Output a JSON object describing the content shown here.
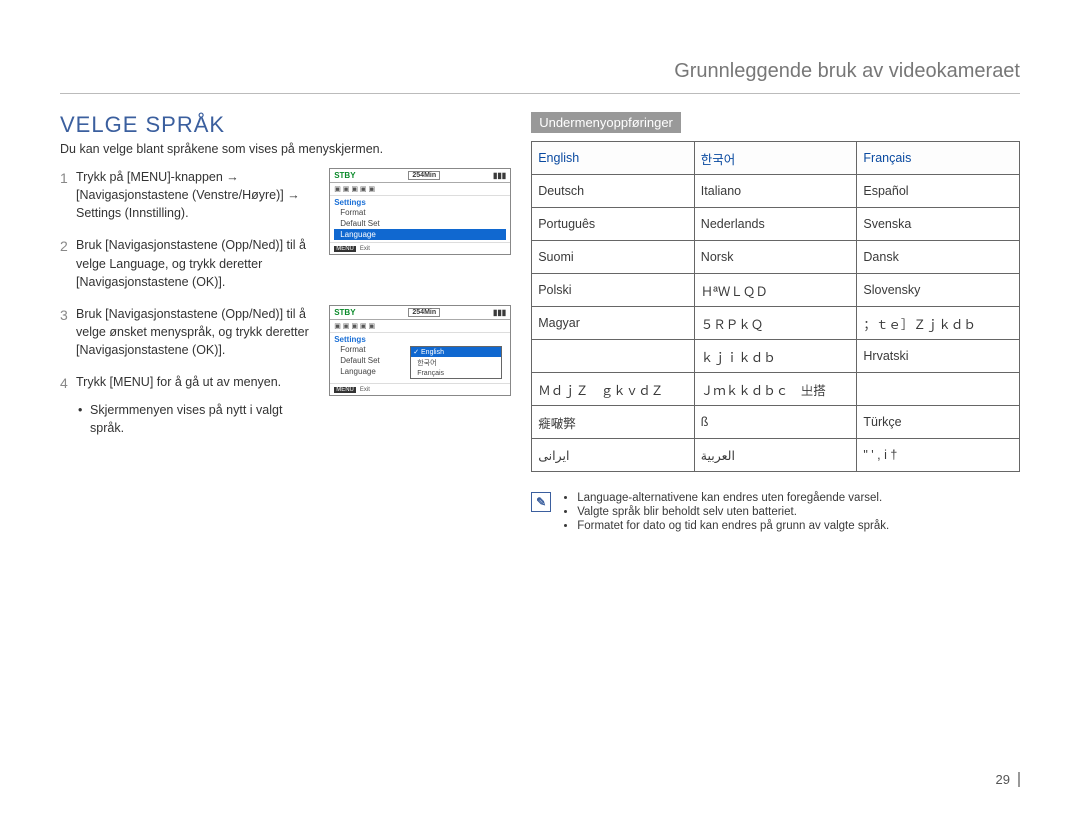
{
  "header": {
    "breadcrumb": "Grunnleggende bruk av videokameraet"
  },
  "page_number": "29",
  "left": {
    "title": "VELGE SPRÅK",
    "intro": "Du kan velge blant språkene som vises på menyskjermen.",
    "steps": [
      {
        "num": "1",
        "text": "Trykk på [MENU]-knappen → [Navigasjonstastene (Venstre/Høyre)] → Settings (Innstilling)."
      },
      {
        "num": "2",
        "text": "Bruk [Navigasjonstastene (Opp/Ned)] til å velge Language, og trykk deretter [Navigasjonstastene (OK)]."
      },
      {
        "num": "3",
        "text": "Bruk [Navigasjonstastene (Opp/Ned)] til å velge ønsket menyspråk, og trykk deretter [Navigasjonstastene (OK)]."
      },
      {
        "num": "4",
        "text": "Trykk [MENU] for å gå ut av menyen.",
        "bullet": "Skjermmenyen vises på nytt i valgt språk."
      }
    ]
  },
  "osd": {
    "stby": "STBY",
    "time": "254Min",
    "settings_label": "Settings",
    "items": [
      "Format",
      "Default Set",
      "Language"
    ],
    "selected": "Language",
    "exit_label": "Exit",
    "menu_label": "MENU",
    "sub_options": [
      "English",
      "한국어",
      "Français"
    ],
    "sub_selected": "English"
  },
  "right": {
    "chip": "Undermenyoppføringer",
    "table": [
      [
        "English",
        "한국어",
        "Français"
      ],
      [
        "Deutsch",
        "Italiano",
        "Español"
      ],
      [
        "Português",
        "Nederlands",
        "Svenska"
      ],
      [
        "Suomi",
        "Norsk",
        "Dansk"
      ],
      [
        "Polski",
        "ＨªＷＬＱＤ",
        "Slovensky"
      ],
      [
        "Magyar",
        "５ＲＰｋＱ",
        "；ｔｅ］Ｚｊｋｄｂ"
      ],
      [
        "",
        "ｋｊｉｋｄｂ",
        "Hrvatski"
      ],
      [
        "ＭｄｊＺ　ｇｋｖｄＺ",
        "Ｊｍｋｋｄｂｃ　㞢搭",
        ""
      ],
      [
        "㿅㗞㢣",
        "ß",
        "Türkçe"
      ],
      [
        "ایرانی",
        "العربية",
        "\" ' , i †"
      ]
    ],
    "highlight_cells": [
      [
        0,
        0
      ],
      [
        0,
        1
      ],
      [
        0,
        2
      ]
    ],
    "notes": [
      "Language-alternativene kan endres uten foregående varsel.",
      "Valgte språk blir beholdt selv uten batteriet.",
      "Formatet for dato og tid kan endres på grunn av valgte språk."
    ]
  }
}
